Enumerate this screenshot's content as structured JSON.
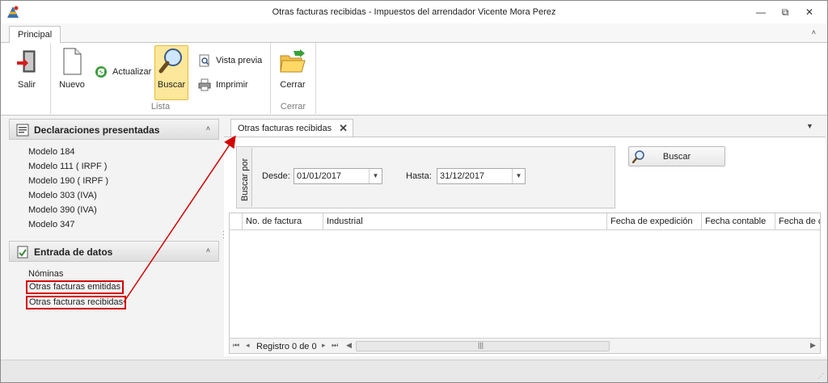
{
  "window": {
    "title": "Otras facturas recibidas - Impuestos del arrendador Vicente Mora Perez",
    "min_glyph": "—",
    "restore_glyph": "⧉",
    "close_glyph": "✕"
  },
  "ribbon": {
    "tab": "Principal",
    "collapse_glyph": "˄",
    "buttons": {
      "salir": "Salir",
      "nuevo": "Nuevo",
      "actualizar": "Actualizar",
      "buscar": "Buscar",
      "vista_previa": "Vista previa",
      "imprimir": "Imprimir",
      "cerrar": "Cerrar"
    },
    "groups": {
      "lista": "Lista",
      "cerrar": "Cerrar"
    }
  },
  "sidebar": {
    "declaraciones": {
      "title": "Declaraciones presentadas",
      "items": [
        "Modelo 184",
        "Modelo 111 ( IRPF )",
        "Modelo 190 ( IRPF )",
        "Modelo 303 (IVA)",
        "Modelo 390 (IVA)",
        "Modelo 347"
      ]
    },
    "entrada": {
      "title": "Entrada de datos",
      "items": [
        "Nóminas",
        "Otras facturas emitidas",
        "Otras facturas recibidas"
      ]
    },
    "chevron_glyph": "˄"
  },
  "document": {
    "tab_label": "Otras facturas recibidas",
    "tab_close": "✕",
    "search": {
      "group_label": "Buscar por",
      "desde_label": "Desde:",
      "desde_value": "01/01/2017",
      "hasta_label": "Hasta:",
      "hasta_value": "31/12/2017",
      "button": "Buscar"
    },
    "grid": {
      "columns": [
        "No. de factura",
        "Industrial",
        "Fecha de expedición",
        "Fecha contable",
        "Fecha de c"
      ],
      "record_text": "Registro 0 de 0"
    }
  },
  "colors": {
    "annotation": "#d40000",
    "active_button": "#fce79a"
  }
}
